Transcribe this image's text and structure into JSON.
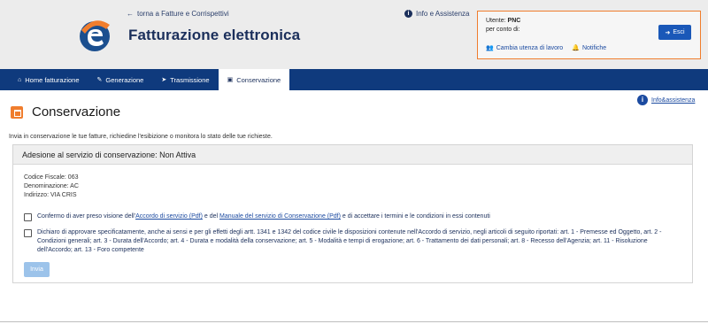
{
  "header": {
    "back_link": "torna a Fatture e Corrispettivi",
    "app_title": "Fatturazione elettronica",
    "info_link": "Info e Assistenza"
  },
  "user": {
    "label": "Utente:",
    "name": "PNC",
    "per_conto": "per conto di:",
    "change_link": "Cambia utenza di lavoro",
    "notifications_link": "Notifiche",
    "exit_label": "Esci"
  },
  "nav": {
    "items": [
      {
        "label": "Home fatturazione",
        "icon": "home-icon"
      },
      {
        "label": "Generazione",
        "icon": "pencil-icon"
      },
      {
        "label": "Trasmissione",
        "icon": "send-icon"
      },
      {
        "label": "Conservazione",
        "icon": "archive-icon"
      }
    ]
  },
  "page": {
    "title": "Conservazione",
    "help_link": "Info&assistenza",
    "subtitle": "Invia in conservazione le tue fatture, richiedine l'esibizione o monitora lo stato delle tue richieste."
  },
  "panel": {
    "heading": "Adesione al servizio di conservazione: Non Attiva",
    "fields": [
      "Codice Fiscale: 063",
      "Denominazione: AC",
      "Indirizzo: VIA CRIS"
    ],
    "check1": {
      "pre": "Confermo di aver preso visione dell'",
      "link1": "Accordo di servizio (Pdf)",
      "mid": " e del ",
      "link2": "Manuale del servizio di Conservazione (Pdf)",
      "post": " e di accettare i termini e le condizioni in essi contenuti"
    },
    "check2": "Dichiaro di approvare specificatamente, anche ai sensi e per gli effetti degli artt. 1341 e 1342 del codice civile le disposizioni contenute nell'Accordo di servizio, negli articoli di seguito riportati: art. 1 - Premesse ed Oggetto, art. 2 - Condizioni generali; art. 3 - Durata dell'Accordo; art. 4 - Durata e modalità della conservazione; art. 5 - Modalità e tempi di erogazione; art. 6 - Trattamento dei dati personali; art. 8 - Recesso dell'Agenzia; art. 11 - Risoluzione dell'Accordo; art. 13 - Foro competente",
    "submit_label": "Invia"
  },
  "colors": {
    "nav_bg": "#0f3a7d",
    "accent": "#f07d2d",
    "primary_button": "#1a58b8",
    "disabled_button": "#9cc3ea"
  }
}
